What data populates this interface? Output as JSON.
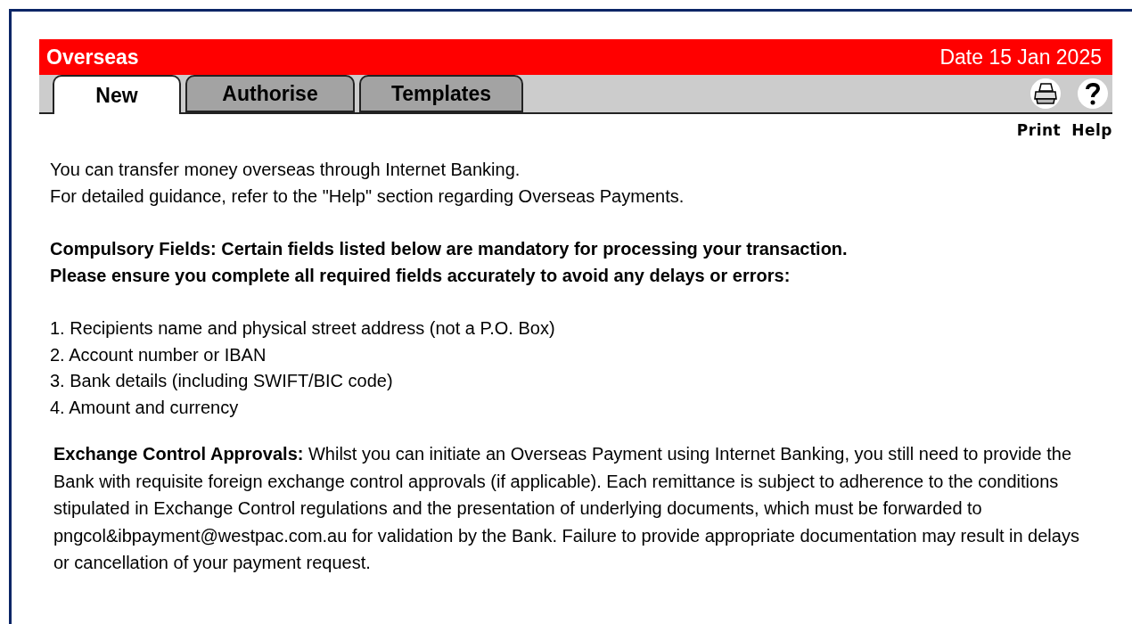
{
  "header": {
    "title": "Overseas",
    "date": "Date 15 Jan 2025"
  },
  "tabs": [
    {
      "label": "New",
      "selected": true
    },
    {
      "label": "Authorise",
      "selected": false
    },
    {
      "label": "Templates",
      "selected": false
    }
  ],
  "tools": [
    {
      "kind": "print",
      "label": "Print"
    },
    {
      "kind": "help",
      "label": "Help"
    }
  ],
  "intro": [
    "You can transfer money overseas through Internet Banking.",
    "For detailed guidance, refer to the \"Help\" section regarding Overseas Payments."
  ],
  "compulsory": [
    "Compulsory Fields: Certain fields listed below are mandatory for processing your transaction.",
    "Please ensure you complete all required fields accurately to avoid any delays or errors:"
  ],
  "requirements": [
    "1. Recipients name and physical street address (not a P.O. Box)",
    "2. Account number or IBAN",
    "3. Bank details (including SWIFT/BIC code)",
    "4. Amount and currency"
  ],
  "exchange_note": "**Exchange Control Approvals:** Whilst you can initiate an Overseas Payment using Internet Banking, you still need to provide the Bank with requisite foreign exchange control approvals (if applicable). Each remittance is subject to adherence to the conditions stipulated in Exchange Control regulations and the presentation of underlying documents, which must be forwarded to pngcol&ibpayment@westpac.com.au for validation by the Bank. Failure to provide appropriate documentation may result in delays or cancellation of your payment request."
}
